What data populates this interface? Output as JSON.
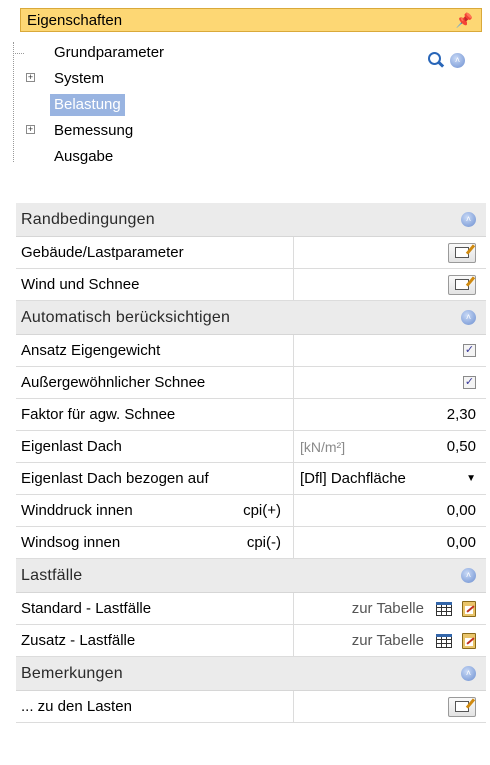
{
  "panel": {
    "title": "Eigenschaften",
    "pin_glyph": "†"
  },
  "tree": {
    "items": [
      {
        "label": "Grundparameter",
        "expandable": false
      },
      {
        "label": "System",
        "expandable": true
      },
      {
        "label": "Belastung",
        "expandable": false,
        "selected": true
      },
      {
        "label": "Bemessung",
        "expandable": true
      },
      {
        "label": "Ausgabe",
        "expandable": false
      }
    ],
    "expander_glyph": "+"
  },
  "sections": {
    "randbedingungen": {
      "title": "Randbedingungen",
      "rows": {
        "gebaeude": {
          "label": "Gebäude/Lastparameter"
        },
        "wind": {
          "label": "Wind und Schnee"
        }
      }
    },
    "automatisch": {
      "title": "Automatisch berücksichtigen",
      "rows": {
        "eigengewicht": {
          "label": "Ansatz Eigengewicht",
          "checked": true
        },
        "schnee": {
          "label": "Außergewöhnlicher Schnee",
          "checked": true
        }
      }
    },
    "parameter": {
      "rows": {
        "faktor": {
          "label": "Faktor für agw. Schnee",
          "value": "2,30"
        },
        "eigenlast": {
          "label": "Eigenlast Dach",
          "unit": "[kN/m²]",
          "value": "0,50"
        },
        "bezogen": {
          "label": "Eigenlast Dach bezogen auf",
          "value": "[Dfl] Dachfläche"
        },
        "winddruck": {
          "label": "Winddruck innen",
          "symbol": "cpi(+)",
          "value": "0,00"
        },
        "windsog": {
          "label": "Windsog innen",
          "symbol": "cpi(-)",
          "value": "0,00"
        }
      }
    },
    "lastfaelle": {
      "title": "Lastfälle",
      "rows": {
        "standard": {
          "label": "Standard - Lastfälle",
          "link": "zur Tabelle"
        },
        "zusatz": {
          "label": "Zusatz - Lastfälle",
          "link": "zur Tabelle"
        }
      }
    },
    "bemerkungen": {
      "title": "Bemerkungen",
      "rows": {
        "lasten": {
          "label": "... zu den Lasten"
        }
      }
    }
  },
  "glyphs": {
    "check": "✓",
    "collapse": "˄",
    "dropdown": "▼"
  },
  "icons": [
    "pin-icon",
    "search-icon",
    "collapse-all-icon",
    "edit-icon",
    "table-icon",
    "clipboard-edit-icon"
  ]
}
